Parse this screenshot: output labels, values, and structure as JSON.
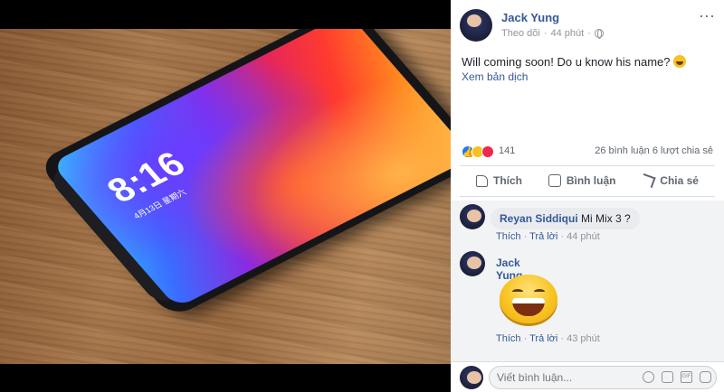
{
  "photo": {
    "phone_clock": "8:16",
    "phone_date": "4月13日 星期六"
  },
  "post": {
    "author": "Jack Yung",
    "follow_label": "Theo dõi",
    "separator": "·",
    "time": "44 phút",
    "privacy_icon": "globe-icon",
    "text": "Will coming soon! Do u know his name?",
    "translate_link": "Xem bản dịch",
    "reaction_count": "141",
    "comments_count": "26 bình luận",
    "shares_count": "6 lượt chia sẻ",
    "actions": {
      "like": "Thích",
      "comment": "Bình luận",
      "share": "Chia sẻ"
    }
  },
  "comments": [
    {
      "name": "Reyan Siddiqui",
      "text": "Mi Mix 3 ?",
      "like": "Thích",
      "reply": "Trả lời",
      "time": "44 phút"
    },
    {
      "name": "Jack Yung",
      "sticker": "laughing-sticker",
      "like": "Thích",
      "reply": "Trả lời",
      "time": "43 phút"
    }
  ],
  "composer": {
    "placeholder": "Viết bình luận..."
  },
  "colors": {
    "link": "#365899",
    "muted": "#90949c",
    "like_blue": "#2078f4",
    "love_red": "#f0284a",
    "wow_yellow": "#f7c21f"
  }
}
